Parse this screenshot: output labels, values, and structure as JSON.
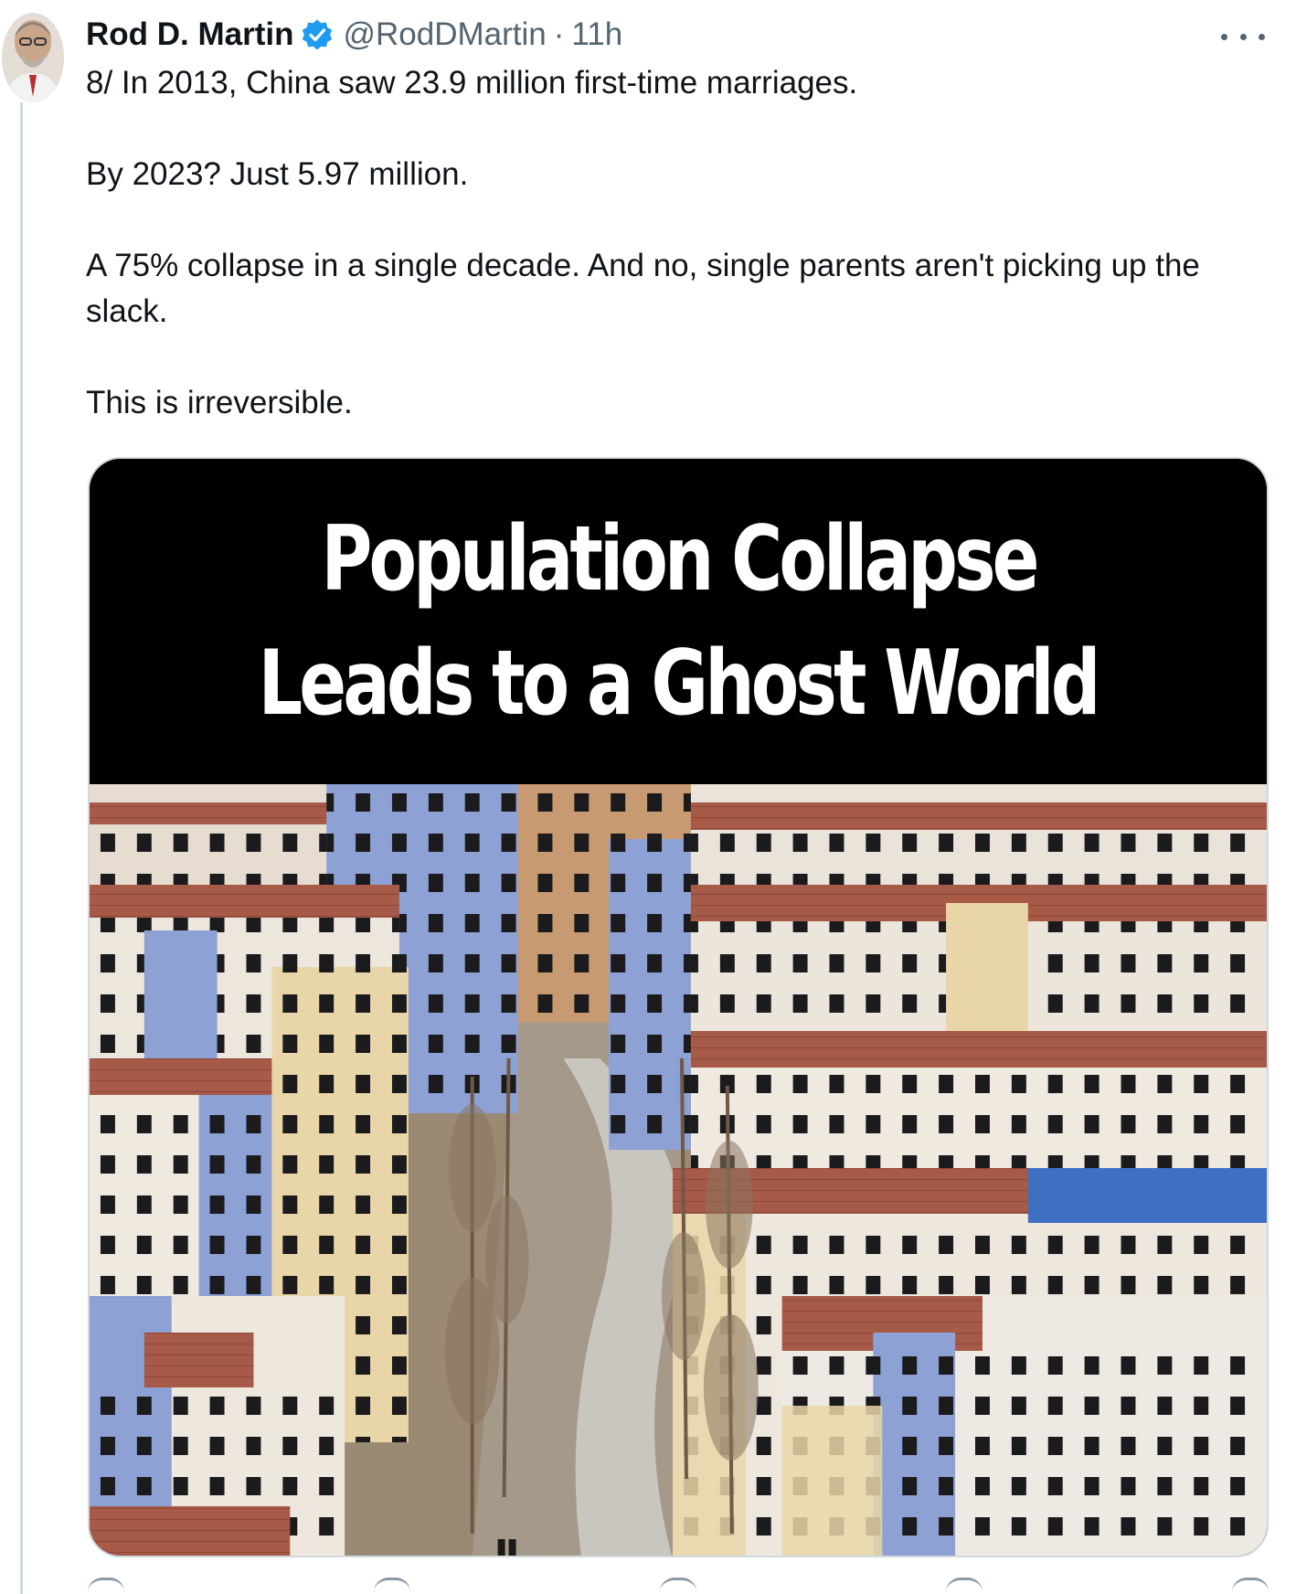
{
  "tweet": {
    "author_name": "Rod D. Martin",
    "handle": "@RodDMartin",
    "separator": "·",
    "time": "11h",
    "paragraphs": [
      "8/ In 2013, China saw 23.9 million first-time marriages.",
      "By 2023? Just 5.97 million.",
      "A 75% collapse in a single decade. And no, single parents aren't picking up the slack.",
      "This is irreversible."
    ]
  },
  "media": {
    "headline_line1": "Population Collapse",
    "headline_line2": "Leads to a Ghost World"
  },
  "icons": {
    "verified": "verified-badge-icon",
    "more": "more-options-icon",
    "reply": "reply-icon",
    "repost": "repost-icon",
    "like": "like-icon",
    "views": "views-icon",
    "share": "share-icon"
  },
  "colors": {
    "verified_blue": "#1d9bf0",
    "secondary_text": "#536471",
    "primary_text": "#0f1419"
  }
}
